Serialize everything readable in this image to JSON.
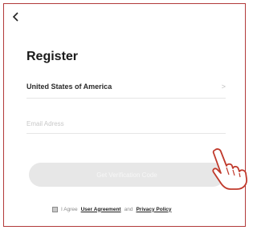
{
  "header": {
    "back_icon": "chevron-left-icon"
  },
  "page": {
    "title": "Register"
  },
  "form": {
    "country": "United States of America",
    "country_chevron": ">",
    "email_placeholder": "Email Adress",
    "email_value": "",
    "submit_label": "Get Verification Code"
  },
  "agreement": {
    "prefix": "I Agree",
    "user_agreement": "User Agreement",
    "and": "and",
    "privacy_policy": "Privacy Policy"
  },
  "overlay": {
    "pointer_icon": "hand-pointer-icon"
  },
  "colors": {
    "frame_border": "#b23a3a",
    "button_bg": "#e7e7e7",
    "pointer_stroke": "#c0392b"
  }
}
